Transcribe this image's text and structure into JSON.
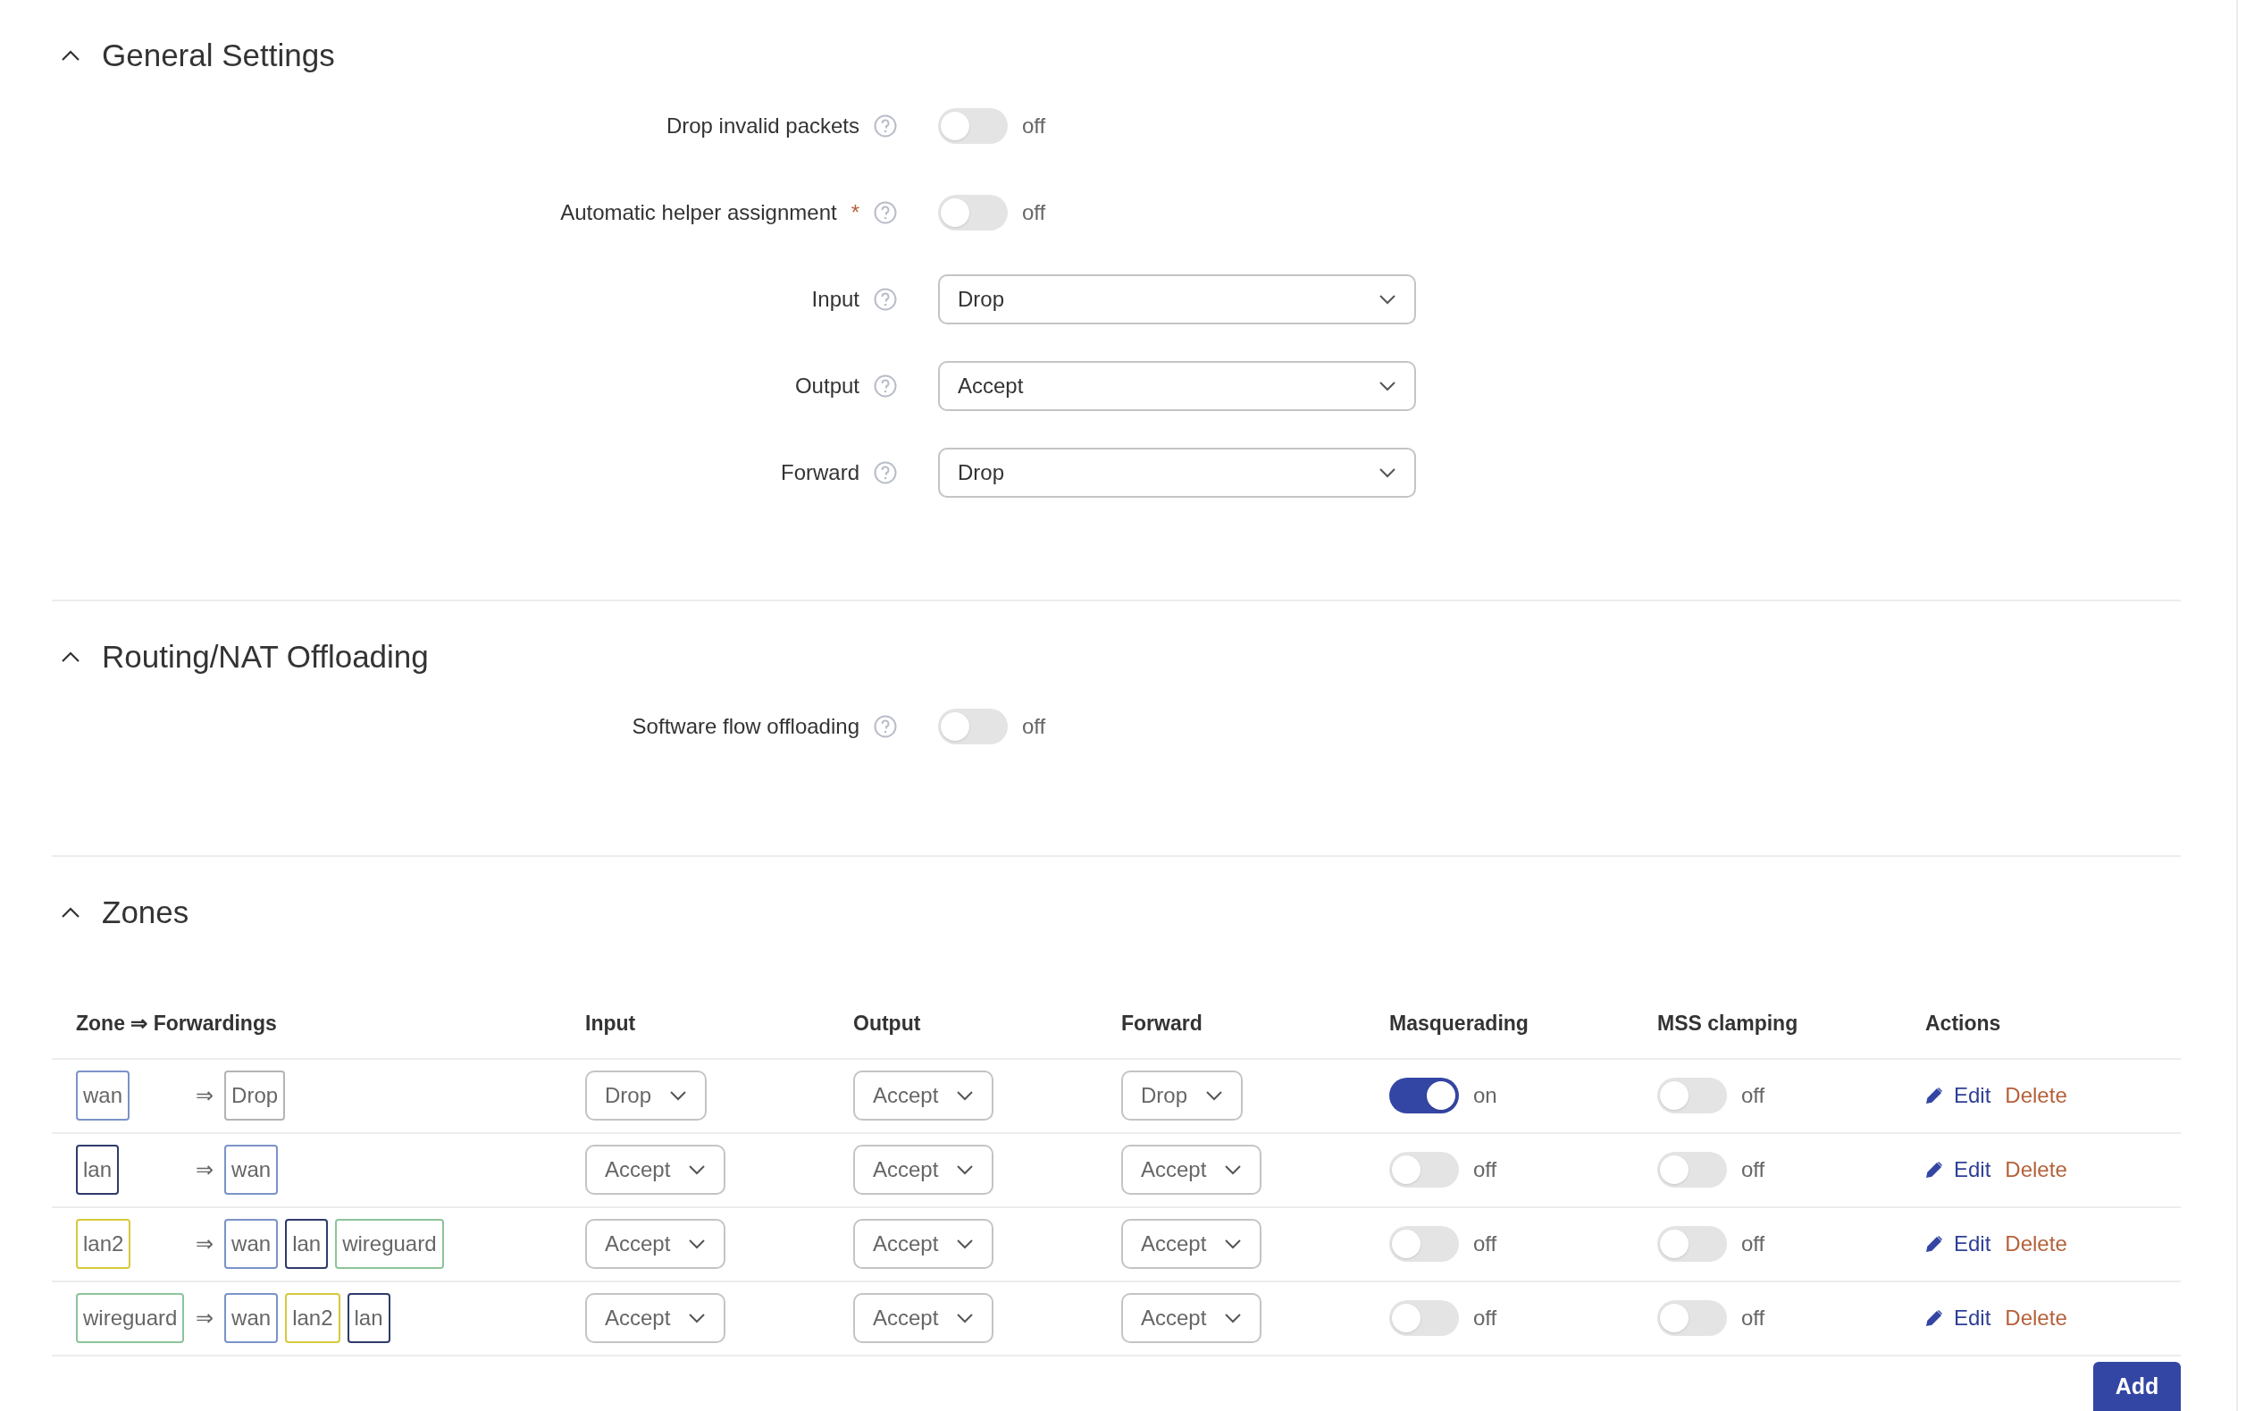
{
  "sections": [
    {
      "title": "General Settings",
      "expanded": true,
      "items": [
        {
          "kind": "toggle",
          "label": "Drop invalid packets",
          "on": false,
          "state_text": "off"
        },
        {
          "kind": "toggle",
          "label": "Automatic helper assignment",
          "required_mark": "*",
          "on": false,
          "state_text": "off"
        },
        {
          "kind": "select",
          "label": "Input",
          "value": "Drop"
        },
        {
          "kind": "select",
          "label": "Output",
          "value": "Accept"
        },
        {
          "kind": "select",
          "label": "Forward",
          "value": "Drop"
        }
      ]
    },
    {
      "title": "Routing/NAT Offloading",
      "expanded": true,
      "items": [
        {
          "kind": "toggle",
          "label": "Software flow offloading",
          "on": false,
          "state_text": "off"
        }
      ]
    }
  ],
  "zones": {
    "title": "Zones",
    "expanded": true,
    "columns": [
      "Zone ⇒ Forwardings",
      "Input",
      "Output",
      "Forward",
      "Masquerading",
      "MSS clamping",
      "Actions"
    ],
    "rows": [
      {
        "zone": {
          "name": "wan",
          "color": "#7b93c8"
        },
        "arrow": "⇒",
        "forwardings": [
          {
            "name": "Drop",
            "color": "#b4b4b4"
          }
        ],
        "input": "Drop",
        "output": "Accept",
        "forward": "Drop",
        "masquerading": {
          "on": true,
          "text": "on"
        },
        "mss_clamping": {
          "on": false,
          "text": "off"
        },
        "edit": "Edit",
        "delete": "Delete"
      },
      {
        "zone": {
          "name": "lan",
          "color": "#2f3b6b"
        },
        "arrow": "⇒",
        "forwardings": [
          {
            "name": "wan",
            "color": "#7b93c8"
          }
        ],
        "input": "Accept",
        "output": "Accept",
        "forward": "Accept",
        "masquerading": {
          "on": false,
          "text": "off"
        },
        "mss_clamping": {
          "on": false,
          "text": "off"
        },
        "edit": "Edit",
        "delete": "Delete"
      },
      {
        "zone": {
          "name": "lan2",
          "color": "#d6c93c"
        },
        "arrow": "⇒",
        "forwardings": [
          {
            "name": "wan",
            "color": "#7b93c8"
          },
          {
            "name": "lan",
            "color": "#2f3b6b"
          },
          {
            "name": "wireguard",
            "color": "#8cc49a"
          }
        ],
        "input": "Accept",
        "output": "Accept",
        "forward": "Accept",
        "masquerading": {
          "on": false,
          "text": "off"
        },
        "mss_clamping": {
          "on": false,
          "text": "off"
        },
        "edit": "Edit",
        "delete": "Delete"
      },
      {
        "zone": {
          "name": "wireguard",
          "color": "#8cc49a"
        },
        "arrow": "⇒",
        "forwardings": [
          {
            "name": "wan",
            "color": "#7b93c8"
          },
          {
            "name": "lan2",
            "color": "#d6c93c"
          },
          {
            "name": "lan",
            "color": "#2f3b6b"
          }
        ],
        "input": "Accept",
        "output": "Accept",
        "forward": "Accept",
        "masquerading": {
          "on": false,
          "text": "off"
        },
        "mss_clamping": {
          "on": false,
          "text": "off"
        },
        "edit": "Edit",
        "delete": "Delete"
      }
    ],
    "add_button": "Add"
  }
}
